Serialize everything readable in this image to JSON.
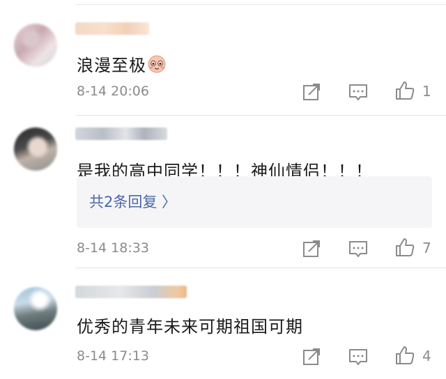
{
  "comments": [
    {
      "text": "浪漫至极",
      "emoji": "blush-face-emoji",
      "timestamp": "8-14 20:06",
      "likes": "1"
    },
    {
      "text": "是我的高中同学！！！神仙情侣！！！",
      "timestamp": "8-14 18:33",
      "likes": "7",
      "replies_label": "共2条回复 〉"
    },
    {
      "text": "优秀的青年未来可期祖国可期",
      "timestamp": "8-14 17:13",
      "likes": "4"
    }
  ],
  "icons": {
    "share": "share-icon",
    "comment": "comment-icon",
    "like": "thumbs-up-icon"
  },
  "colors": {
    "link": "#4a67a3",
    "meta": "#8a8a8a",
    "text": "#1a1a1a",
    "reply_bg": "#f5f5f7"
  }
}
